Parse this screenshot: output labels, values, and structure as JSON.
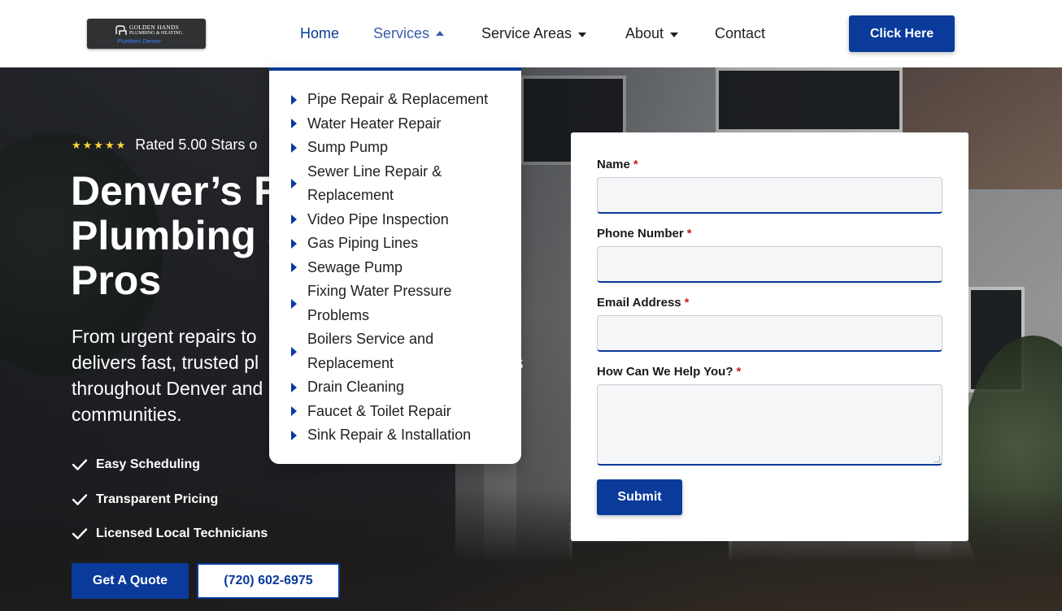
{
  "logo": {
    "line1": "GOLDEN HANDS",
    "line2": "PLUMBING & HEATING",
    "line3": "Plumbers Denver"
  },
  "nav": {
    "items": [
      {
        "label": "Home"
      },
      {
        "label": "Services"
      },
      {
        "label": "Service Areas"
      },
      {
        "label": "About"
      },
      {
        "label": "Contact"
      }
    ],
    "cta_label": "Click Here"
  },
  "dropdown": {
    "items": [
      "Pipe Repair & Replacement",
      "Water Heater Repair",
      "Sump Pump",
      "Sewer Line Repair & Replacement",
      "Video Pipe Inspection",
      "Gas Piping Lines",
      "Sewage Pump",
      "Fixing Water Pressure Problems",
      "Boilers Service and Replacement",
      "Drain Cleaning",
      "Faucet & Toilet Repair",
      "Sink Repair & Installation"
    ]
  },
  "hero": {
    "rating_stars": "★★★★★",
    "rating_text": "Rated 5.00 Stars o",
    "title_line1": "Denver’s R",
    "title_line2": "Plumbing &",
    "title_line3": "Pros",
    "subtitle_line1": "From urgent repairs to",
    "subtitle_line2": "delivers fast, trusted pl",
    "subtitle_line2_tail": "s",
    "subtitle_line3": "throughout Denver and",
    "subtitle_line4": "communities.",
    "checks": [
      "Easy Scheduling",
      "Transparent Pricing",
      "Licensed Local Technicians"
    ],
    "quote_label": "Get A Quote",
    "phone_label": "(720) 602-6975"
  },
  "form": {
    "name_label": "Name",
    "phone_label": "Phone Number",
    "email_label": "Email Address",
    "help_label": "How Can We Help You?",
    "required_mark": "*",
    "submit_label": "Submit"
  },
  "colors": {
    "brand_blue": "#0a3a9a",
    "star_yellow": "#ffd43b",
    "required_red": "#c81e1e"
  }
}
